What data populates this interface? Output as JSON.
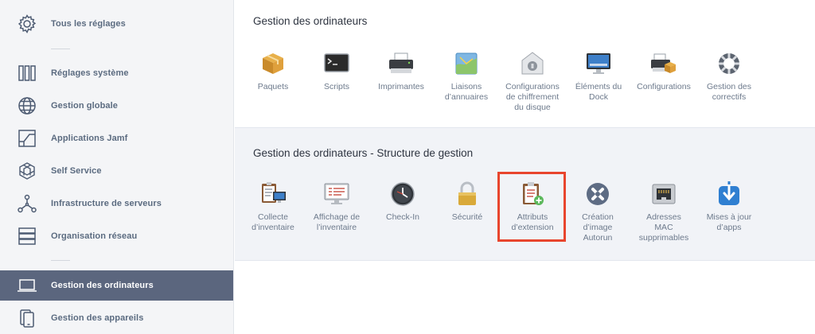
{
  "sidebar": {
    "items": [
      {
        "name": "sidebar-item-all-settings",
        "icon": "gear-icon",
        "label": "Tous les réglages"
      },
      {
        "name": "sidebar-item-system-settings",
        "icon": "columns-icon",
        "label": "Réglages système"
      },
      {
        "name": "sidebar-item-global-management",
        "icon": "globe-icon",
        "label": "Gestion globale"
      },
      {
        "name": "sidebar-item-jamf-apps",
        "icon": "app-frame-icon",
        "label": "Applications Jamf"
      },
      {
        "name": "sidebar-item-self-service",
        "icon": "self-service-icon",
        "label": "Self Service"
      },
      {
        "name": "sidebar-item-server-infrastructure",
        "icon": "network-nodes-icon",
        "label": "Infrastructure de serveurs"
      },
      {
        "name": "sidebar-item-network-organization",
        "icon": "server-rack-icon",
        "label": "Organisation réseau"
      },
      {
        "name": "sidebar-item-computer-management",
        "icon": "laptop-icon",
        "label": "Gestion des ordinateurs",
        "active": true
      },
      {
        "name": "sidebar-item-device-management",
        "icon": "mobile-device-icon",
        "label": "Gestion des appareils"
      }
    ]
  },
  "main": {
    "section1": {
      "title": "Gestion des ordinateurs",
      "tiles": [
        {
          "icon": "package-icon",
          "label": "Paquets"
        },
        {
          "icon": "terminal-icon",
          "label": "Scripts"
        },
        {
          "icon": "printer-icon",
          "label": "Imprimantes"
        },
        {
          "icon": "directory-map-icon",
          "label": "Liaisons\nd’annuaires"
        },
        {
          "icon": "disk-encryption-icon",
          "label": "Configurations\nde chiffrement\ndu disque"
        },
        {
          "icon": "dock-monitor-icon",
          "label": "Éléments du\nDock"
        },
        {
          "icon": "printer-package-icon",
          "label": "Configurations"
        },
        {
          "icon": "patch-management-icon",
          "label": "Gestion des\ncorrectifs"
        }
      ]
    },
    "section2": {
      "title": "Gestion des ordinateurs - Structure de gestion",
      "tiles": [
        {
          "icon": "inventory-collection-icon",
          "label": "Collecte\nd’inventaire"
        },
        {
          "icon": "inventory-display-icon",
          "label": "Affichage de\nl’inventaire"
        },
        {
          "icon": "check-in-clock-icon",
          "label": "Check-In"
        },
        {
          "icon": "padlock-icon",
          "label": "Sécurité"
        },
        {
          "icon": "extension-attributes-icon",
          "label": "Attributs\nd’extension",
          "highlighted": true
        },
        {
          "icon": "autorun-image-icon",
          "label": "Création\nd’image\nAutorun"
        },
        {
          "icon": "ethernet-port-icon",
          "label": "Adresses\nMAC\nsupprimables"
        },
        {
          "icon": "app-updates-icon",
          "label": "Mises à jour\nd’apps"
        }
      ]
    }
  },
  "colors": {
    "sidebar_bg": "#f4f5f7",
    "active_bg": "#5b667e",
    "highlight": "#e8452d",
    "section2_bg": "#f1f3f7"
  }
}
